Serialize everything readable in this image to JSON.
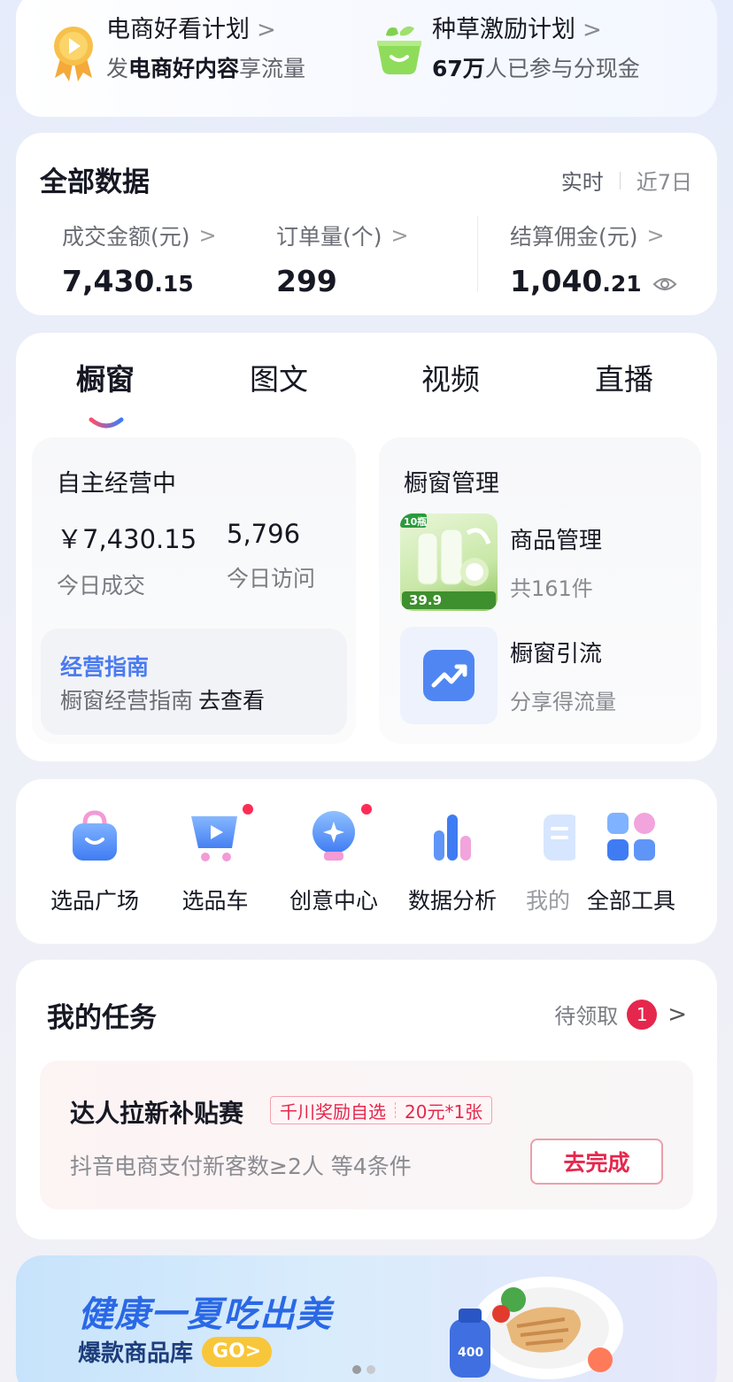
{
  "promo": {
    "left": {
      "title": "电商好看计划",
      "sub_prefix": "发",
      "sub_bold": "电商好内容",
      "sub_suffix": "享流量"
    },
    "right": {
      "title": "种草激励计划",
      "sub_bold": "67万",
      "sub_suffix": "人已参与分现金"
    }
  },
  "data": {
    "title": "全部数据",
    "range_active": "实时",
    "range_other": "近7日",
    "metrics": [
      {
        "label": "成交金额(元)",
        "value_int": "7,430",
        "value_dec": ".15"
      },
      {
        "label": "订单量(个)",
        "value_int": "299",
        "value_dec": ""
      },
      {
        "label": "结算佣金(元)",
        "value_int": "1,040",
        "value_dec": ".21"
      }
    ]
  },
  "showcase": {
    "tabs": [
      "橱窗",
      "图文",
      "视频",
      "直播"
    ],
    "active_tab": "橱窗",
    "left_panel": {
      "title": "自主经营中",
      "stats": [
        {
          "value": "￥7,430.15",
          "label": "今日成交"
        },
        {
          "value": "5,796",
          "label": "今日访问"
        }
      ],
      "guide_title": "经营指南",
      "guide_desc": "橱窗经营指南",
      "guide_link": "去查看"
    },
    "right_panel": {
      "title": "橱窗管理",
      "items": [
        {
          "name": "商品管理",
          "sub": "共161件"
        },
        {
          "name": "橱窗引流",
          "sub": "分享得流量"
        }
      ],
      "thumb_tag": "10瓶",
      "thumb_price": "39.9"
    }
  },
  "tools": [
    {
      "label": "选品广场",
      "dot": false
    },
    {
      "label": "选品车",
      "dot": true
    },
    {
      "label": "创意中心",
      "dot": true
    },
    {
      "label": "数据分析",
      "dot": false
    },
    {
      "label": "我的",
      "dot": false
    },
    {
      "label": "全部工具",
      "dot": false
    }
  ],
  "task": {
    "title": "我的任务",
    "pending_label": "待领取",
    "pending_count": "1",
    "name": "达人拉新补贴赛",
    "reward_a": "千川奖励自选",
    "reward_b": "20元*1张",
    "desc": "抖音电商支付新客数≥2人  等4条件",
    "button": "去完成"
  },
  "banner": {
    "title": "健康一夏吃出美",
    "sub": "爆款商品库",
    "go": "GO>",
    "bottle_label": "400"
  },
  "colors": {
    "accent_blue": "#4a7bf0",
    "accent_red": "#e6274d",
    "text_primary": "#161823",
    "text_secondary": "#8a8b91"
  }
}
